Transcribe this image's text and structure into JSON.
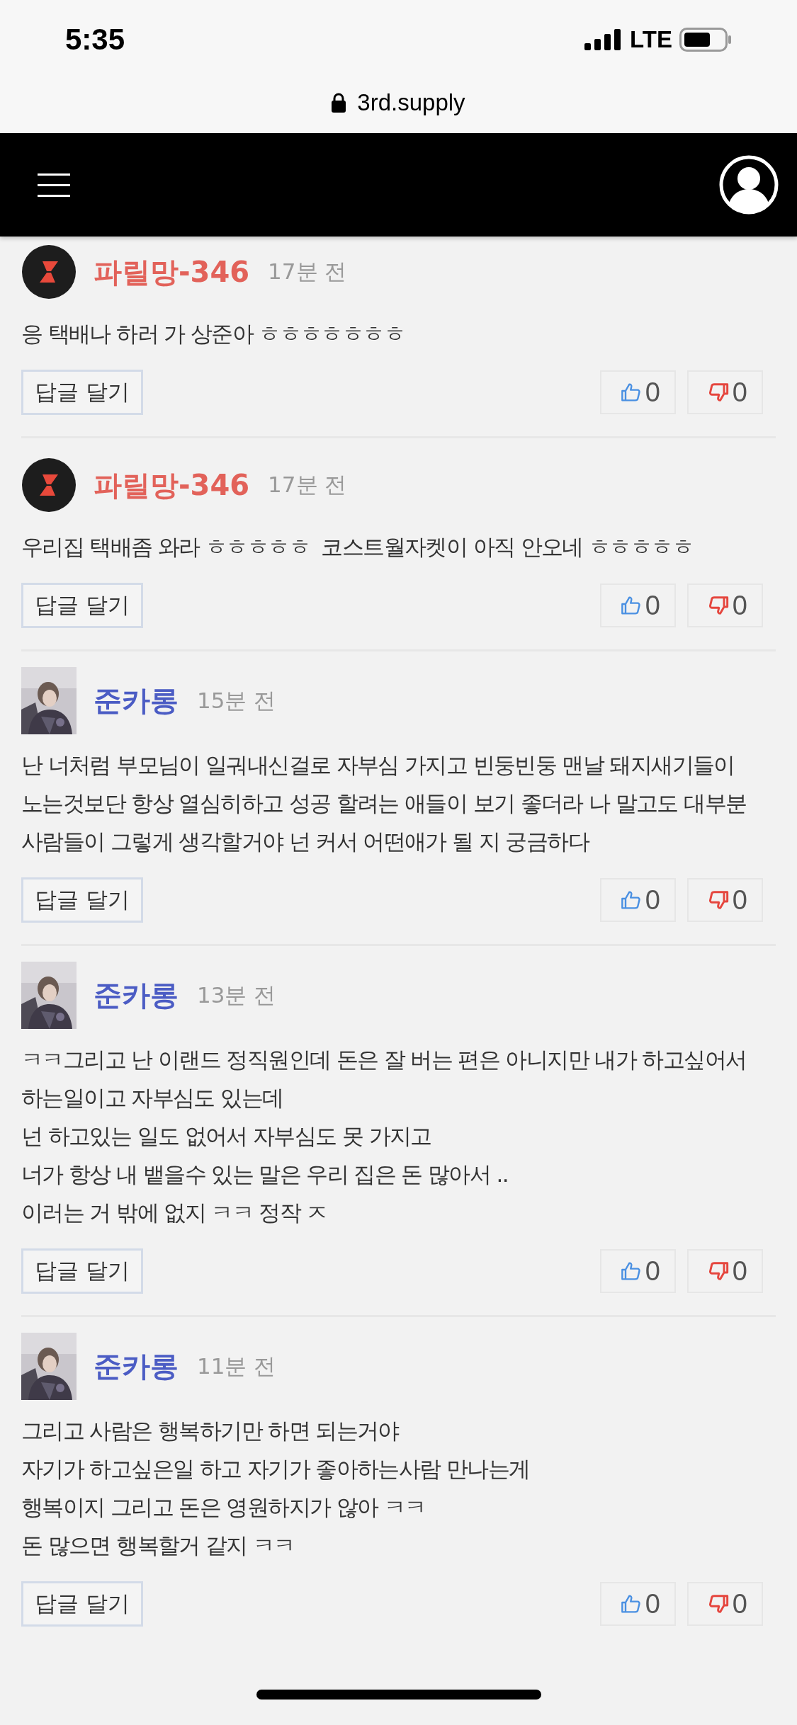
{
  "status_bar": {
    "time": "5:35",
    "network": "LTE"
  },
  "address_bar": {
    "url": "3rd.supply"
  },
  "comments": [
    {
      "avatar": {
        "kind": "logo"
      },
      "author": "파릴망-346",
      "color": "#e2625a",
      "time": "17분 전",
      "body": "응 택배나 하러 가 상준아 ㅎㅎㅎㅎㅎㅎㅎ",
      "reply_label": "답글 달기",
      "likes": "0",
      "dislikes": "0"
    },
    {
      "avatar": {
        "kind": "logo"
      },
      "author": "파릴망-346",
      "color": "#e2625a",
      "time": "17분 전",
      "body": "우리집 택배좀 와라 ㅎㅎㅎㅎㅎ  코스트월자켓이 아직 안오네 ㅎㅎㅎㅎㅎ",
      "reply_label": "답글 달기",
      "likes": "0",
      "dislikes": "0"
    },
    {
      "author": "준카롱",
      "color": "#4b5cc4",
      "time": "15분 전",
      "body": "난 너처럼 부모님이 일궈내신걸로 자부심 가지고 빈둥빈둥 맨날 돼지새기들이 노는것보단 항상 열심히하고 성공 할려는 애들이 보기 좋더라 나 말고도 대부분 사람들이 그렇게 생각할거야 넌 커서 어떤애가 될 지 궁금하다",
      "reply_label": "답글 달기",
      "likes": "0",
      "dislikes": "0"
    },
    {
      "author": "준카롱",
      "color": "#4b5cc4",
      "time": "13분 전",
      "body": "ㅋㅋ그리고 난 이랜드 정직원인데 돈은 잘 버는 편은 아니지만 내가 하고싶어서 하는일이고 자부심도 있는데\n넌 하고있는 일도 없어서 자부심도 못 가지고\n너가 항상 내 뱉을수 있는 말은 우리 집은 돈 많아서 ..\n이러는 거 밖에 없지 ㅋㅋ 정작 ㅈ",
      "reply_label": "답글 달기",
      "likes": "0",
      "dislikes": "0"
    },
    {
      "author": "준카롱",
      "color": "#4b5cc4",
      "time": "11분 전",
      "body": "그리고 사람은 행복하기만 하면 되는거야\n자기가 하고싶은일 하고 자기가 좋아하는사람 만나는게\n행복이지 그리고 돈은 영원하지가 않아 ㅋㅋ\n돈 많으면 행복할거 같지 ㅋㅋ",
      "reply_label": "답글 달기",
      "likes": "0",
      "dislikes": "0"
    }
  ]
}
